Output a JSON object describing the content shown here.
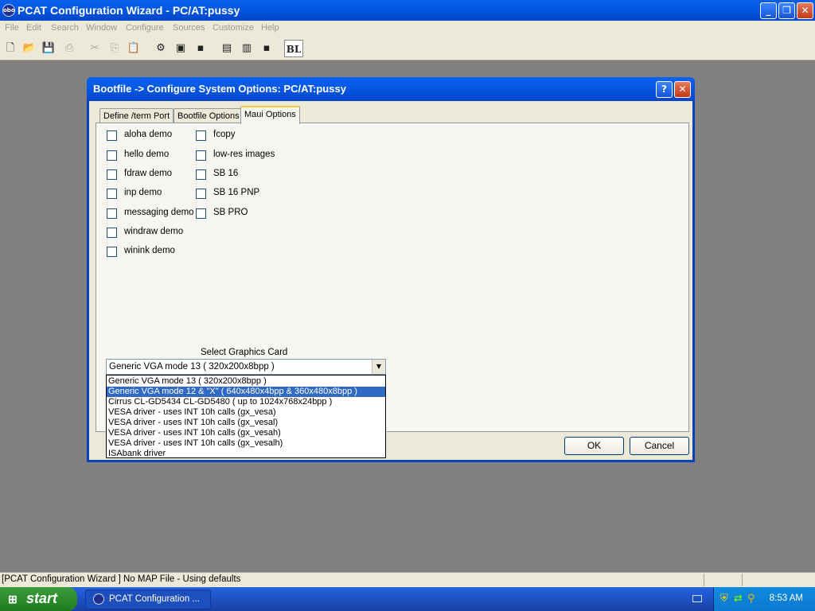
{
  "app": {
    "title": "PCAT Configuration Wizard  - PC/AT:pussy",
    "icon_label": "obo"
  },
  "window_buttons": {
    "minimize": "_",
    "maximize": "❐",
    "close": "✕"
  },
  "menu": [
    "File",
    "Edit",
    "Search",
    "Window",
    "Configure",
    "Sources",
    "Customize",
    "Help"
  ],
  "toolbar": {
    "icons": [
      "new-file-icon",
      "open-folder-icon",
      "save-icon",
      "print-icon",
      "cut-icon",
      "copy-icon",
      "paste-icon",
      "config-a-icon",
      "config-b-icon",
      "disk-icon",
      "build-a-icon",
      "build-b-icon",
      "disk-b-icon"
    ],
    "bl_label": "BL"
  },
  "dialog": {
    "title": "Bootfile -> Configure System Options: PC/AT:pussy",
    "help_btn": "?",
    "close_btn": "✕",
    "tabs": [
      "Define /term Port",
      "Bootfile Options",
      "Maui Options"
    ],
    "active_tab": "Maui Options",
    "checkboxes_col1": [
      "aloha demo",
      "hello demo",
      "fdraw demo",
      "inp demo",
      "messaging demo",
      "windraw demo",
      "winink demo"
    ],
    "checkboxes_col2": [
      "fcopy",
      "low-res images",
      "SB 16",
      "SB 16 PNP",
      "SB PRO"
    ],
    "graphics_label": "Select Graphics Card",
    "graphics_value": "Generic VGA mode 13 ( 320x200x8bpp )",
    "graphics_options": [
      "Generic VGA mode 13 ( 320x200x8bpp )",
      "Generic VGA mode 12 & \"X\" ( 640x480x4bpp & 360x480x8bpp )",
      "Cirrus CL-GD5434 CL-GD5480 ( up to 1024x768x24bpp )",
      "VESA driver - uses INT 10h calls (gx_vesa)",
      "VESA driver - uses INT 10h calls (gx_vesal)",
      "VESA driver - uses INT 10h calls  (gx_vesah)",
      "VESA driver - uses INT 10h calls  (gx_vesalh)",
      "ISAbank driver"
    ],
    "selected_option_index": 1,
    "ok": "OK",
    "cancel": "Cancel"
  },
  "status": {
    "text": "[PCAT Configuration Wizard ] No MAP File - Using defaults"
  },
  "taskbar": {
    "start": "start",
    "task": "PCAT Configuration ...",
    "clock": "8:53 AM"
  }
}
